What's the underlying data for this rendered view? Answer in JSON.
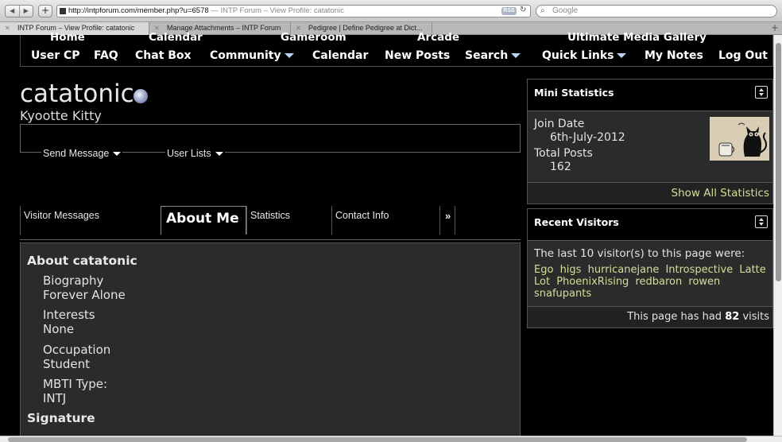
{
  "browser": {
    "url": "http://intpforum.com/member.php?u=6578",
    "page_title": "INTP Forum – View Profile: catatonic",
    "rss_label": "RSS",
    "search_placeholder": "Google",
    "tabs": [
      {
        "label": "INTP Forum – View Profile: catatonic"
      },
      {
        "label": "Manage Attachments – INTP Forum"
      },
      {
        "label": "Pedigree | Define Pedigree at Dict..."
      }
    ]
  },
  "navbar": {
    "row1": [
      "Home",
      "Calendar",
      "Gameroom",
      "Arcade",
      "Ultimate Media Gallery"
    ],
    "row2": [
      "User CP",
      "FAQ",
      "Chat Box",
      "Community",
      "Calendar",
      "New Posts",
      "Search",
      "Quick Links",
      "My Notes",
      "Log Out"
    ]
  },
  "profile": {
    "username": "catatonic",
    "usertitle": "Kyootte Kitty",
    "send_message": "Send Message",
    "user_lists": "User Lists",
    "tabs": [
      "Visitor Messages",
      "About Me",
      "Statistics",
      "Contact Info",
      "»"
    ]
  },
  "about": {
    "heading": "About catatonic",
    "fields": [
      {
        "label": "Biography",
        "value": "Forever Alone"
      },
      {
        "label": "Interests",
        "value": "None"
      },
      {
        "label": "Occupation",
        "value": "Student"
      },
      {
        "label": "MBTI Type:",
        "value": "INTJ"
      }
    ],
    "signature_heading": "Signature"
  },
  "mini_stats": {
    "title": "Mini Statistics",
    "join_date_label": "Join Date",
    "join_date": "6th-July-2012",
    "total_posts_label": "Total Posts",
    "total_posts": "162",
    "show_all": "Show All Statistics"
  },
  "recent_visitors": {
    "title": "Recent Visitors",
    "intro": "The last 10 visitor(s) to this page were:",
    "visitors": [
      "Ego",
      "higs",
      "hurricanejane",
      "Introspective",
      "Latte",
      "Lot",
      "PhoenixRising",
      "redbaron",
      "rowen",
      "snafupants"
    ],
    "visits_prefix": "This page has had",
    "visits_count": "82",
    "visits_suffix": "visits"
  }
}
